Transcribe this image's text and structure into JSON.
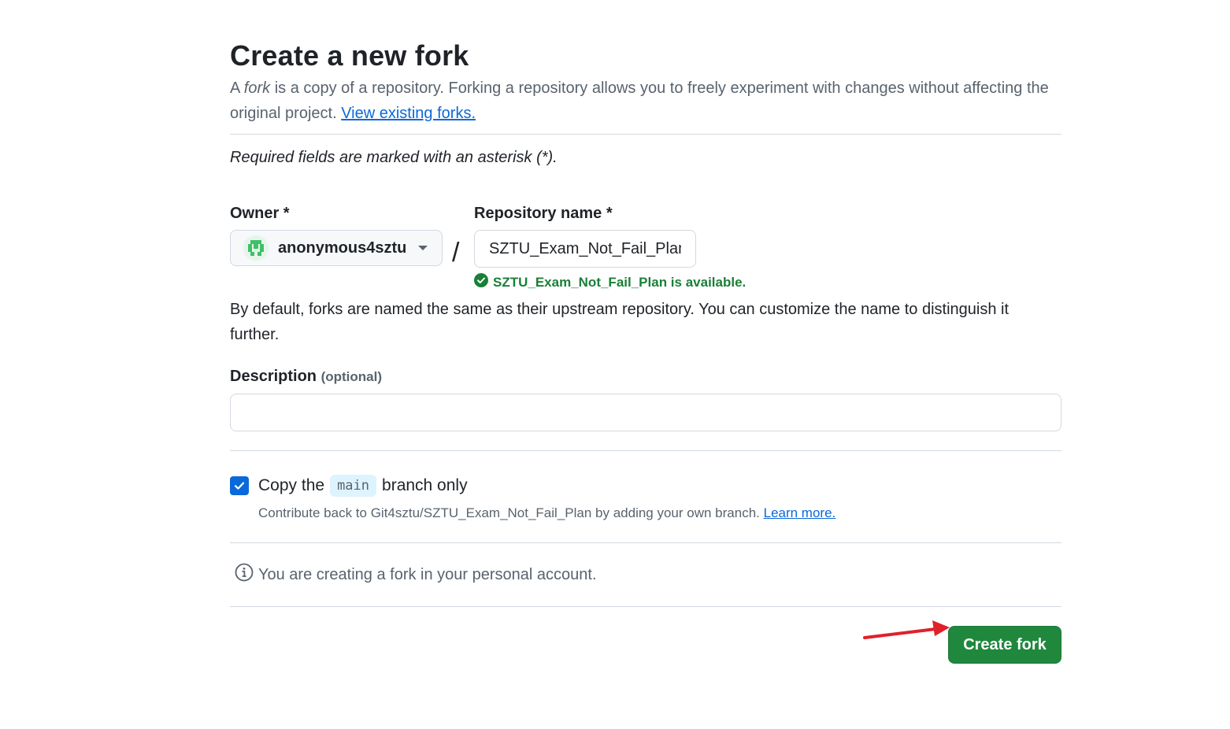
{
  "header": {
    "title": "Create a new fork",
    "subtitle_prefix": "A ",
    "subtitle_fork_word": "fork",
    "subtitle_rest": " is a copy of a repository. Forking a repository allows you to freely experiment with changes without affecting the original project. ",
    "view_forks_link": "View existing forks."
  },
  "form": {
    "required_note": "Required fields are marked with an asterisk (*).",
    "owner": {
      "label": "Owner *",
      "value": "anonymous4sztu",
      "avatar_icon": "identicon-avatar",
      "dropdown_icon": "triangle-down-icon"
    },
    "separator": "/",
    "repo": {
      "label": "Repository name *",
      "value": "SZTU_Exam_Not_Fail_Plan",
      "availability": "SZTU_Exam_Not_Fail_Plan is available.",
      "availability_icon": "check-circle-icon"
    },
    "default_note": "By default, forks are named the same as their upstream repository. You can customize the name to distinguish it further.",
    "description": {
      "label": "Description",
      "optional": "(optional)",
      "value": ""
    },
    "copy_branch": {
      "checked": true,
      "text_before": "Copy the",
      "branch": "main",
      "text_after": "branch only",
      "contribute_text": "Contribute back to Git4sztu/SZTU_Exam_Not_Fail_Plan by adding your own branch. ",
      "learn_more": "Learn more."
    },
    "info": {
      "icon": "info-icon",
      "text": "You are creating a fork in your personal account."
    },
    "submit_label": "Create fork"
  },
  "colors": {
    "primary_button": "#1f883d",
    "link": "#0969da",
    "success": "#1a7f37",
    "annotation_arrow": "#e0202a"
  }
}
